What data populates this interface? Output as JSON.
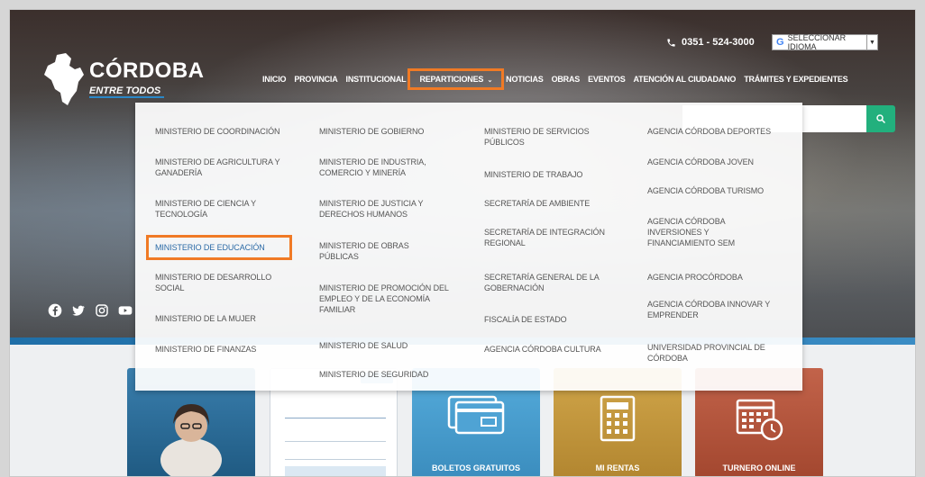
{
  "header": {
    "phone": "0351 - 524-3000",
    "language_select": "SELECCIONAR IDIOMA",
    "logo": {
      "name": "CÓRDOBA",
      "tagline": "ENTRE TODOS"
    }
  },
  "nav": {
    "items": [
      {
        "label": "INICIO"
      },
      {
        "label": "PROVINCIA"
      },
      {
        "label": "INSTITUCIONAL"
      },
      {
        "label": "REPARTICIONES",
        "active": true
      },
      {
        "label": "NOTICIAS"
      },
      {
        "label": "OBRAS"
      },
      {
        "label": "EVENTOS"
      },
      {
        "label": "ATENCIÓN AL CIUDADANO"
      },
      {
        "label": "TRÁMITES Y EXPEDIENTES"
      }
    ]
  },
  "search": {
    "placeholder": ""
  },
  "social_icons": [
    "facebook-icon",
    "twitter-icon",
    "instagram-icon",
    "youtube-icon"
  ],
  "dropdown": {
    "columns": [
      [
        "MINISTERIO DE COORDINACIÓN",
        "MINISTERIO DE AGRICULTURA Y GANADERÍA",
        "MINISTERIO DE CIENCIA Y TECNOLOGÍA",
        "MINISTERIO DE EDUCACIÓN",
        "MINISTERIO DE DESARROLLO SOCIAL",
        "MINISTERIO DE LA MUJER",
        "MINISTERIO DE FINANZAS"
      ],
      [
        "MINISTERIO DE GOBIERNO",
        "MINISTERIO DE INDUSTRIA, COMERCIO Y MINERÍA",
        "MINISTERIO DE JUSTICIA Y DERECHOS HUMANOS",
        "MINISTERIO DE OBRAS PÚBLICAS",
        "MINISTERIO DE PROMOCIÓN DEL EMPLEO Y DE LA ECONOMÍA FAMILIAR",
        "MINISTERIO DE SALUD",
        "MINISTERIO DE SEGURIDAD"
      ],
      [
        "MINISTERIO DE SERVICIOS PÚBLICOS",
        "MINISTERIO DE TRABAJO",
        "SECRETARÍA DE AMBIENTE",
        "SECRETARÍA DE INTEGRACIÓN REGIONAL",
        "SECRETARÍA GENERAL DE LA GOBERNACIÓN",
        "FISCALÍA DE ESTADO",
        "AGENCIA CÓRDOBA CULTURA"
      ],
      [
        "AGENCIA CÓRDOBA DEPORTES",
        "AGENCIA CÓRDOBA JOVEN",
        "AGENCIA CÓRDOBA TURISMO",
        "AGENCIA CÓRDOBA INVERSIONES Y FINANCIAMIENTO SEM",
        "AGENCIA PROCÓRDOBA",
        "AGENCIA CÓRDOBA INNOVAR Y EMPRENDER",
        "UNIVERSIDAD PROVINCIAL DE CÓRDOBA"
      ]
    ],
    "active_item": "MINISTERIO DE EDUCACIÓN"
  },
  "cards": [
    {
      "label": "",
      "color": "#2f6f9a"
    },
    {
      "label": "",
      "color": "#ffffff"
    },
    {
      "label": "BOLETOS GRATUITOS",
      "color": "#4aa3d6"
    },
    {
      "label": "MI RENTAS",
      "color": "#c59a3a"
    },
    {
      "label": "TURNERO ONLINE",
      "color": "#b5563c"
    }
  ],
  "colors": {
    "highlight": "#f07a25",
    "search_button": "#22b07d",
    "accent_blue": "#2a88c9"
  }
}
